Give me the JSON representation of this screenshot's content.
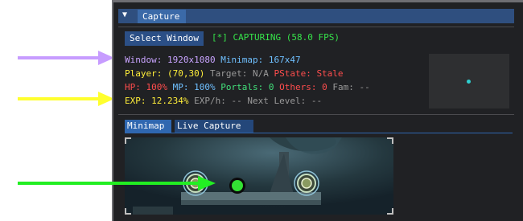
{
  "header": {
    "collapse_icon": "triangle-down-icon",
    "title": "Capture"
  },
  "select_window_button": "Select Window",
  "capture_status": "[*] CAPTURING (58.0 FPS)",
  "info": {
    "window_label": "Window:",
    "window_value": "1920x1080",
    "minimap_label": "Minimap:",
    "minimap_value": "167x47",
    "player_label": "Player:",
    "player_value": "(70,30)",
    "target_label": "Target:",
    "target_value": "N/A",
    "pstate_label": "PState:",
    "pstate_value": "Stale",
    "hp_label": "HP:",
    "hp_value": "100%",
    "mp_label": "MP:",
    "mp_value": "100%",
    "portals_label": "Portals:",
    "portals_value": "0",
    "others_label": "Others:",
    "others_value": "0",
    "fam_label": "Fam:",
    "fam_value": "--",
    "exp_label": "EXP:",
    "exp_value": "12.234%",
    "exph_label": "EXP/h:",
    "exph_value": "--",
    "nextlevel_label": "Next Level:",
    "nextlevel_value": "--"
  },
  "tabs": [
    "Minimap",
    "Live Capture"
  ],
  "annotation_arrow_colors": [
    "#c79cff",
    "#ffff2e",
    "#22ee22"
  ],
  "colors": {
    "header_bg": "#2f4f7f",
    "panel_bg": "#202124",
    "status_green": "#36e34a",
    "player_dot": "#2ed0d0"
  }
}
